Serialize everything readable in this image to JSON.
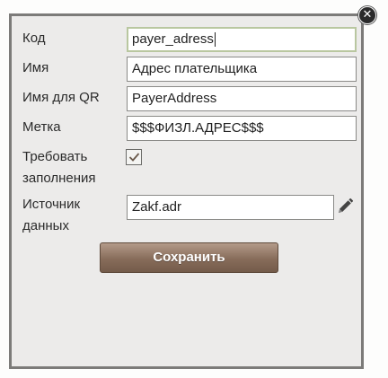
{
  "dialog": {
    "close_icon": "close-icon",
    "fields": {
      "code": {
        "label": "Код",
        "value": "payer_adress"
      },
      "name": {
        "label": "Имя",
        "value": "Адрес плательщика"
      },
      "qr_name": {
        "label": "Имя для QR",
        "value": "PayerAddress"
      },
      "mark": {
        "label": "Метка",
        "value": "$$$ФИЗЛ.АДРЕС$$$"
      },
      "required": {
        "label_line1": "Требовать",
        "label_line2": "заполнения",
        "checked": true
      },
      "source": {
        "label_line1": "Источник",
        "label_line2": "данных",
        "value": "Zakf.adr",
        "edit_icon": "pencil-icon"
      }
    },
    "save_label": "Сохранить"
  },
  "colors": {
    "dialog_bg": "#ecebea",
    "dialog_border": "#7c7b79",
    "focus_border": "#b9c7a0",
    "button_brown": "#876c5a"
  }
}
